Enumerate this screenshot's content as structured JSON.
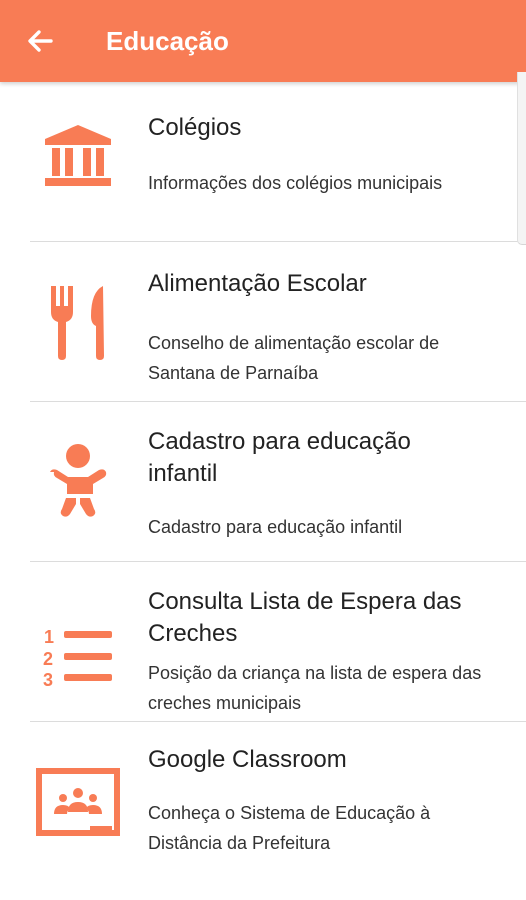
{
  "appbar": {
    "title": "Educação",
    "back_icon": "arrow-back-icon",
    "color": "#f87c55"
  },
  "items": [
    {
      "icon": "building-columns-icon",
      "title": "Colégios",
      "description": "Informações dos colégios municipais"
    },
    {
      "icon": "fork-knife-icon",
      "title": "Alimentação Escolar",
      "description": "Conselho de alimentação escolar de Santana de Parnaíba"
    },
    {
      "icon": "baby-icon",
      "title": "Cadastro para educação infantil",
      "description": "Cadastro para educação infantil"
    },
    {
      "icon": "numbered-list-icon",
      "title": "Consulta Lista de Espera das Creches",
      "description": "Posição da criança na lista de espera das creches municipais"
    },
    {
      "icon": "classroom-icon",
      "title": "Google Classroom",
      "description": "Conheça o Sistema de Educação à Distância da Prefeitura"
    }
  ],
  "accent_color": "#f87c55"
}
